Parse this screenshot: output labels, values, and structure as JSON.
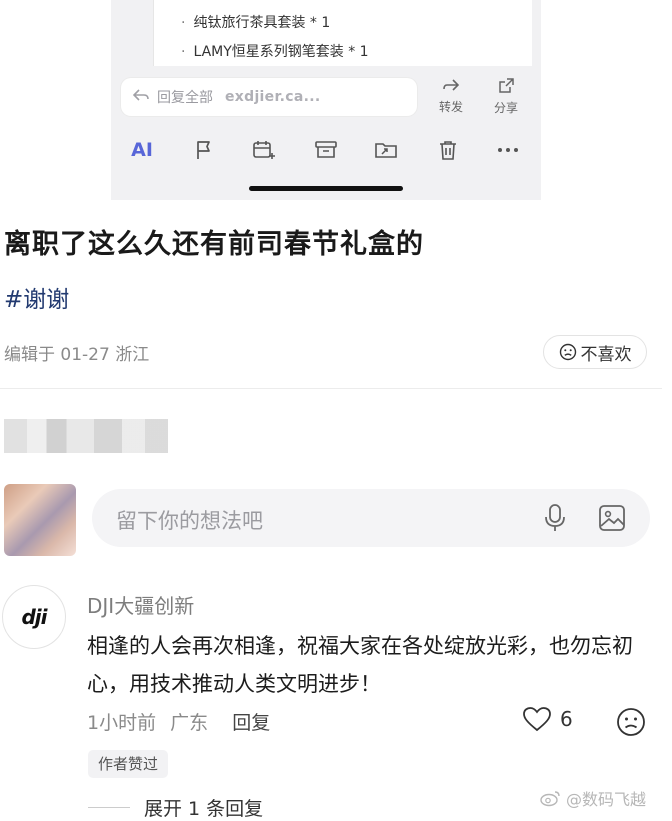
{
  "mail": {
    "items": [
      "纯钛旅行茶具套装 * 1",
      "LAMY恒星系列钢笔套装 * 1"
    ],
    "reply_all_label": "回复全部",
    "reply_address": "exdjier.ca...",
    "forward_label": "转发",
    "share_label": "分享",
    "ai_label": "AI"
  },
  "post": {
    "title": "离职了这么久还有前司春节礼盒的",
    "hashtag": "#谢谢",
    "meta": "编辑于 01-27 浙江",
    "dislike_label": "不喜欢"
  },
  "comment_box": {
    "placeholder": "留下你的想法吧"
  },
  "comment": {
    "author": "DJI大疆创新",
    "avatar_text": "dji",
    "text": "相逢的人会再次相逢，祝福大家在各处绽放光彩，也勿忘初心，用技术推动人类文明进步！",
    "time": "1小时前",
    "location": "广东",
    "reply_label": "回复",
    "likes": "6",
    "badge": "作者赞过",
    "expand_label": "展开 1 条回复"
  },
  "watermark": "@数码飞越",
  "colors": {
    "ai_accent": "#5866d8",
    "hashtag": "#223a70"
  }
}
